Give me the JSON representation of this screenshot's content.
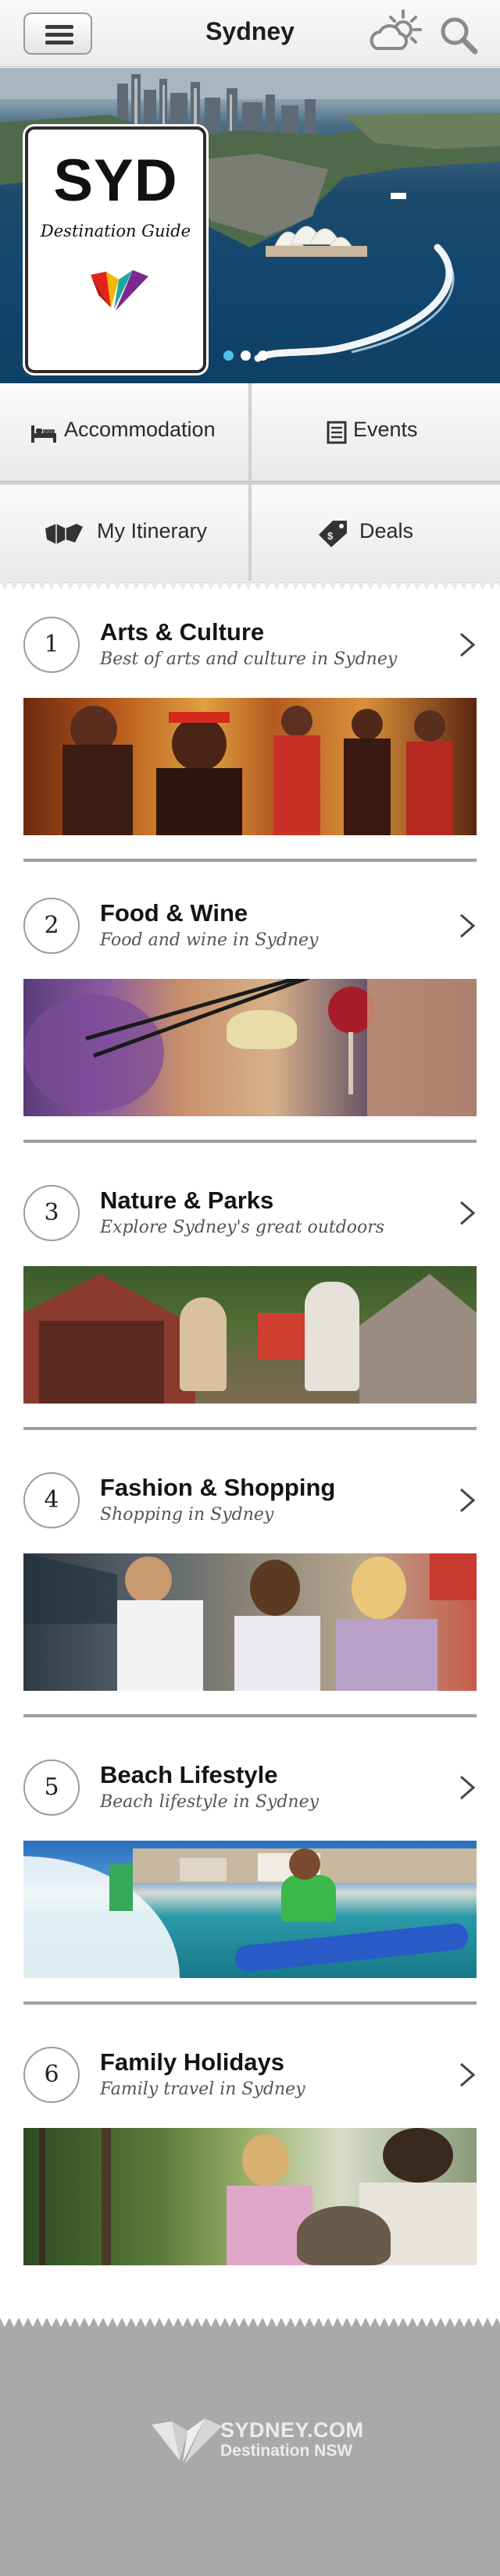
{
  "header": {
    "title": "Sydney",
    "menu_icon": "hamburger-menu-icon",
    "weather_icon": "weather-sun-cloud-icon",
    "search_icon": "search-icon"
  },
  "hero": {
    "badge_title": "SYD",
    "badge_subtitle": "Destination Guide",
    "slides_total": 3,
    "active_slide": 1,
    "image": "sydney-harbour-opera-house-aerial-photo"
  },
  "quick_nav": [
    {
      "label": "Accommodation",
      "icon": "bed-icon"
    },
    {
      "label": "Events",
      "icon": "calendar-list-icon"
    },
    {
      "label": "My Itinerary",
      "icon": "map-icon"
    },
    {
      "label": "Deals",
      "icon": "price-tag-icon"
    }
  ],
  "categories": [
    {
      "number": "1",
      "title": "Arts & Culture",
      "subtitle": "Best of arts and culture in Sydney",
      "image": "aboriginal-performers-photo"
    },
    {
      "number": "2",
      "title": "Food & Wine",
      "subtitle": "Food and wine in Sydney",
      "image": "dumpling-chopsticks-wine-photo"
    },
    {
      "number": "3",
      "title": "Nature & Parks",
      "subtitle": "Explore Sydney's great outdoors",
      "image": "camping-tents-photo"
    },
    {
      "number": "4",
      "title": "Fashion & Shopping",
      "subtitle": "Shopping in Sydney",
      "image": "market-shoppers-photo"
    },
    {
      "number": "5",
      "title": "Beach Lifestyle",
      "subtitle": "Beach lifestyle in Sydney",
      "image": "surfing-bondi-photo"
    },
    {
      "number": "6",
      "title": "Family Holidays",
      "subtitle": "Family travel in Sydney",
      "image": "wombat-family-photo"
    }
  ],
  "footer": {
    "brand": "SYDNEY.COM",
    "sub": "Destination NSW",
    "logo_icon": "sydney-com-logo-icon"
  },
  "colors": {
    "footer_bg": "#a9a9a9",
    "divider": "#9e9e9e",
    "logo_red": "#e2231a",
    "logo_teal": "#22a7a0",
    "logo_purple": "#7c2a8f",
    "logo_yellow": "#f2b705"
  }
}
